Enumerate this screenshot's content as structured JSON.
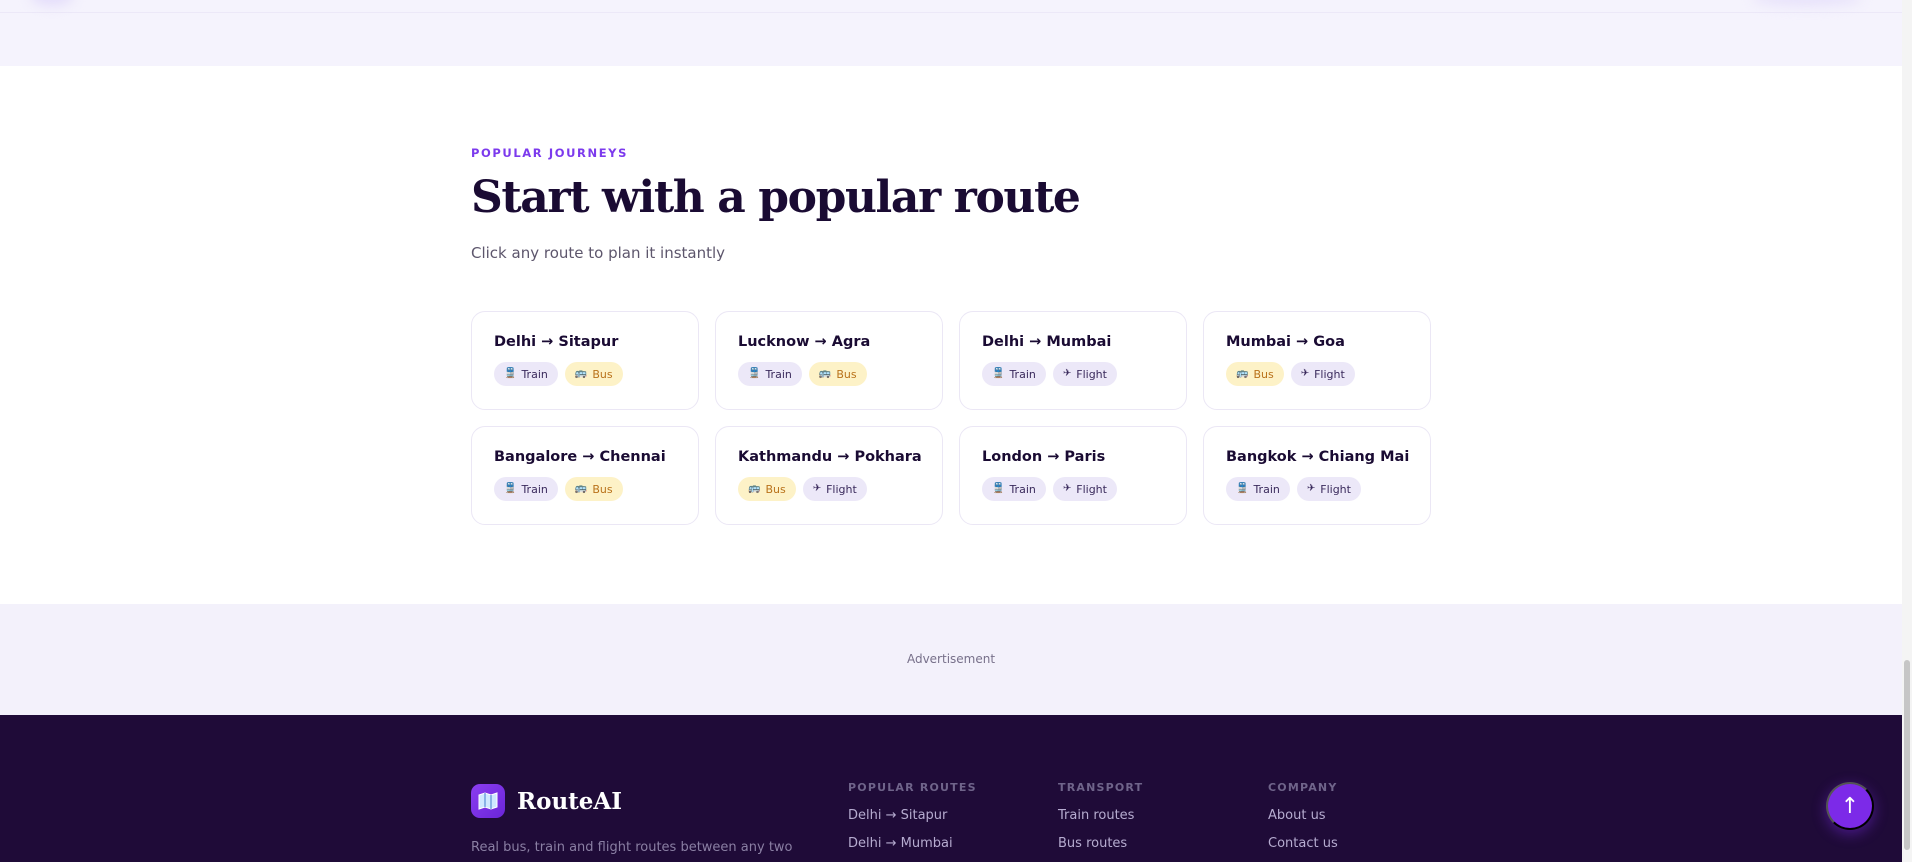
{
  "popular": {
    "eyebrow": "POPULAR JOURNEYS",
    "heading": "Start with a popular route",
    "subheading": "Click any route to plan it instantly",
    "routes": [
      {
        "title": "Delhi → Sitapur",
        "modes": [
          {
            "label": "Train",
            "icon": "train-icon",
            "glyph": "🚆"
          },
          {
            "label": "Bus",
            "icon": "bus-icon",
            "glyph": "🚌"
          }
        ]
      },
      {
        "title": "Lucknow → Agra",
        "modes": [
          {
            "label": "Train",
            "icon": "train-icon",
            "glyph": "🚆"
          },
          {
            "label": "Bus",
            "icon": "bus-icon",
            "glyph": "🚌"
          }
        ]
      },
      {
        "title": "Delhi → Mumbai",
        "modes": [
          {
            "label": "Train",
            "icon": "train-icon",
            "glyph": "🚆"
          },
          {
            "label": "Flight",
            "icon": "airplane-icon",
            "glyph": "✈"
          }
        ]
      },
      {
        "title": "Mumbai → Goa",
        "modes": [
          {
            "label": "Bus",
            "icon": "bus-icon",
            "glyph": "🚌"
          },
          {
            "label": "Flight",
            "icon": "airplane-icon",
            "glyph": "✈"
          }
        ]
      },
      {
        "title": "Bangalore → Chennai",
        "modes": [
          {
            "label": "Train",
            "icon": "train-icon",
            "glyph": "🚆"
          },
          {
            "label": "Bus",
            "icon": "bus-icon",
            "glyph": "🚌"
          }
        ]
      },
      {
        "title": "Kathmandu → Pokhara",
        "modes": [
          {
            "label": "Bus",
            "icon": "bus-icon",
            "glyph": "🚌"
          },
          {
            "label": "Flight",
            "icon": "airplane-icon",
            "glyph": "✈"
          }
        ]
      },
      {
        "title": "London → Paris",
        "modes": [
          {
            "label": "Train",
            "icon": "train-icon",
            "glyph": "🚆"
          },
          {
            "label": "Flight",
            "icon": "airplane-icon",
            "glyph": "✈"
          }
        ]
      },
      {
        "title": "Bangkok → Chiang Mai",
        "modes": [
          {
            "label": "Train",
            "icon": "train-icon",
            "glyph": "🚆"
          },
          {
            "label": "Flight",
            "icon": "airplane-icon",
            "glyph": "✈"
          }
        ]
      }
    ]
  },
  "ad": {
    "label": "Advertisement"
  },
  "footer": {
    "brand_name": "RouteAI",
    "brand_icon": "map-icon",
    "tagline": "Real bus, train and flight routes between any two",
    "columns": [
      {
        "title": "POPULAR ROUTES",
        "links": [
          "Delhi → Sitapur",
          "Delhi → Mumbai"
        ]
      },
      {
        "title": "TRANSPORT",
        "links": [
          "Train routes",
          "Bus routes"
        ]
      },
      {
        "title": "COMPANY",
        "links": [
          "About us",
          "Contact us"
        ]
      }
    ]
  },
  "scroll_top": {
    "icon": "arrow-up-icon",
    "glyph": "↑"
  },
  "colors": {
    "accent": "#7c3aed",
    "heading": "#1a0b33",
    "footer_bg": "#1f0b38",
    "ad_bg": "#f3f1fb",
    "train_badge_bg": "#ece8f8",
    "bus_badge_bg": "#fdf2c7"
  }
}
